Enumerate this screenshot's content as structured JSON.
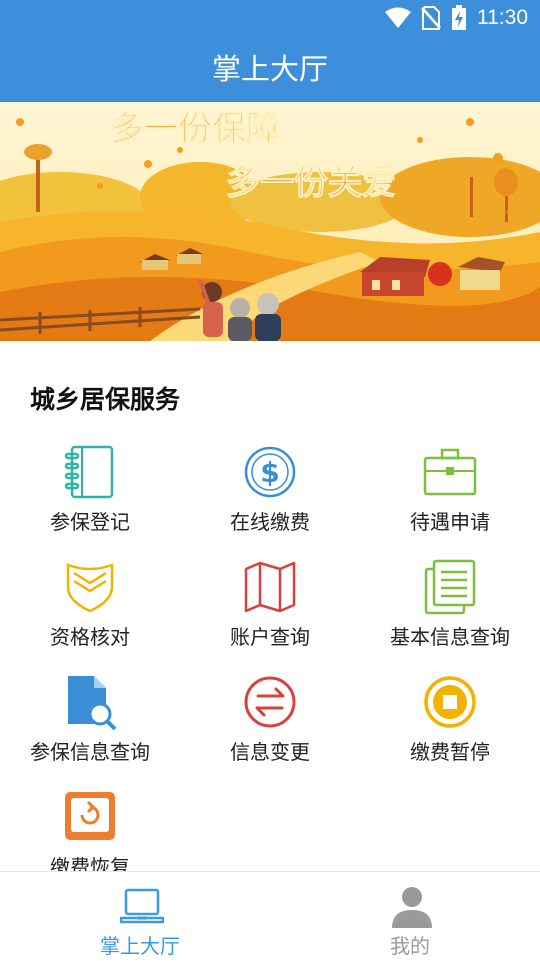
{
  "status_bar": {
    "time": "11:30",
    "icons": [
      "wifi-icon",
      "no-sim-icon",
      "battery-charging-icon"
    ]
  },
  "header": {
    "title": "掌上大厅"
  },
  "banner": {
    "line1": "多一份保障",
    "line2": "多一份关爱"
  },
  "section": {
    "title": "城乡居保服务"
  },
  "services": [
    {
      "label": "参保登记",
      "icon": "notebook-icon",
      "color": "#2bb5a5"
    },
    {
      "label": "在线缴费",
      "icon": "dollar-coin-icon",
      "color": "#3a8ed6"
    },
    {
      "label": "待遇申请",
      "icon": "briefcase-icon",
      "color": "#7dbf3a"
    },
    {
      "label": "资格核对",
      "icon": "shield-check-icon",
      "color": "#f2b200"
    },
    {
      "label": "账户查询",
      "icon": "map-folded-icon",
      "color": "#d9403a"
    },
    {
      "label": "基本信息查询",
      "icon": "documents-icon",
      "color": "#7dbf3a"
    },
    {
      "label": "参保信息查询",
      "icon": "document-search-icon",
      "color": "#3a8ed6"
    },
    {
      "label": "信息变更",
      "icon": "exchange-arrows-icon",
      "color": "#d9403a"
    },
    {
      "label": "缴费暂停",
      "icon": "stop-circle-icon",
      "color": "#f2b200"
    },
    {
      "label": "缴费恢复",
      "icon": "restore-icon",
      "color": "#ef7d2f"
    }
  ],
  "tabs": [
    {
      "label": "掌上大厅",
      "icon": "laptop-icon",
      "active": true,
      "color": "#3a9be0"
    },
    {
      "label": "我的",
      "icon": "user-icon",
      "active": false,
      "color": "#9a9a9a"
    }
  ]
}
